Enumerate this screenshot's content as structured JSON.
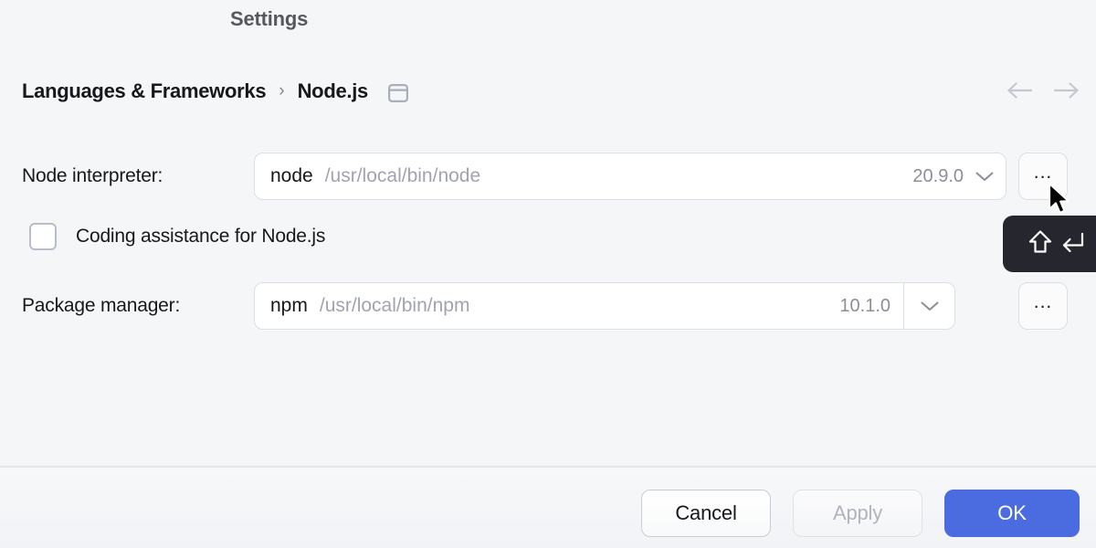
{
  "window": {
    "title": "Settings"
  },
  "breadcrumb": {
    "root": "Languages & Frameworks",
    "separator": "›",
    "current": "Node.js",
    "panel_icon": "panel-icon"
  },
  "navigation": {
    "back_icon": "arrow-left-icon",
    "forward_icon": "arrow-right-icon"
  },
  "form": {
    "interpreter": {
      "label": "Node interpreter:",
      "name": "node",
      "path": "/usr/local/bin/node",
      "version": "20.9.0",
      "chevron_icon": "chevron-down-icon",
      "browse_label": "..."
    },
    "coding_assistance": {
      "label": "Coding assistance for Node.js",
      "checked": false
    },
    "package_manager": {
      "label": "Package manager:",
      "name": "npm",
      "path": "/usr/local/bin/npm",
      "version": "10.1.0",
      "chevron_icon": "chevron-down-icon",
      "browse_label": "..."
    }
  },
  "tooltip": {
    "shift_key": "⇧",
    "enter_key": "⏎",
    "background": "#26272e"
  },
  "footer": {
    "cancel_label": "Cancel",
    "apply_label": "Apply",
    "apply_enabled": false,
    "ok_label": "OK"
  },
  "colors": {
    "background": "#f5f6f8",
    "accent": "#4a6ce0",
    "text": "#17181c",
    "muted_text": "#a0a4ad",
    "border": "#dcdfe5"
  }
}
